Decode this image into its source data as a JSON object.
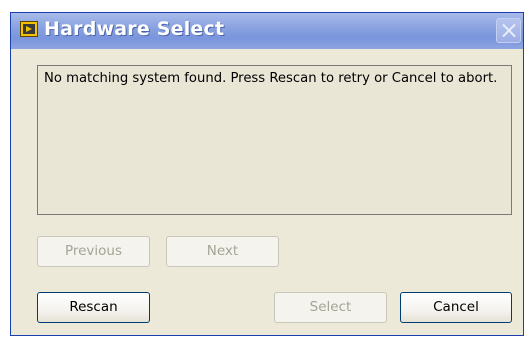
{
  "window": {
    "title": "Hardware Select"
  },
  "message": {
    "text": "No matching system found. Press Rescan to retry or Cancel to abort."
  },
  "buttons": {
    "previous": "Previous",
    "next": "Next",
    "rescan": "Rescan",
    "select": "Select",
    "cancel": "Cancel"
  },
  "colors": {
    "titlebar": "#8aa2e0",
    "window_bg": "#ece9d8",
    "disabled_text": "#a6a495"
  },
  "icons": {
    "app": "labview-app-icon",
    "close": "close-icon"
  }
}
